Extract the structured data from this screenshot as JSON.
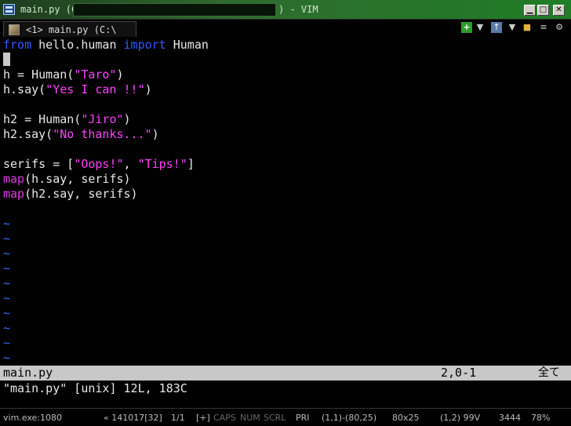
{
  "window": {
    "title_left": "main.py (C:",
    "title_right": ") - VIM"
  },
  "tab": {
    "label": "<1> main.py (C:\\"
  },
  "toolbar_icons": [
    "plus-icon",
    "dropdown-icon",
    "upload-icon",
    "dropdown-icon",
    "lock-icon",
    "gear-icon"
  ],
  "editor": {
    "lines": [
      {
        "parts": [
          {
            "t": "from",
            "c": "kw"
          },
          {
            "t": " hello.human "
          },
          {
            "t": "import",
            "c": "kw"
          },
          {
            "t": " Human"
          }
        ]
      },
      {
        "parts": [],
        "cursor": true
      },
      {
        "parts": [
          {
            "t": "h = Human("
          },
          {
            "t": "\"Taro\"",
            "c": "str"
          },
          {
            "t": ")"
          }
        ]
      },
      {
        "parts": [
          {
            "t": "h.say("
          },
          {
            "t": "\"Yes I can !!\"",
            "c": "str"
          },
          {
            "t": ")"
          }
        ]
      },
      {
        "parts": []
      },
      {
        "parts": [
          {
            "t": "h2 = Human("
          },
          {
            "t": "\"Jiro\"",
            "c": "str"
          },
          {
            "t": ")"
          }
        ]
      },
      {
        "parts": [
          {
            "t": "h2.say("
          },
          {
            "t": "\"No thanks...\"",
            "c": "str"
          },
          {
            "t": ")"
          }
        ]
      },
      {
        "parts": []
      },
      {
        "parts": [
          {
            "t": "serifs = ["
          },
          {
            "t": "\"Oops!\"",
            "c": "str"
          },
          {
            "t": ", "
          },
          {
            "t": "\"Tips!\"",
            "c": "str"
          },
          {
            "t": "]"
          }
        ]
      },
      {
        "parts": [
          {
            "t": "map",
            "c": "fn"
          },
          {
            "t": "(h.say, serifs)"
          }
        ]
      },
      {
        "parts": [
          {
            "t": "map",
            "c": "fn"
          },
          {
            "t": "(h2.say, serifs)"
          }
        ]
      }
    ],
    "tilde": "~",
    "tilde_count": 10
  },
  "statusline": {
    "filename": "main.py",
    "position": "2,0-1",
    "percent": "全て"
  },
  "cmdline": {
    "message": "\"main.py\" [unix] 12L, 183C"
  },
  "console": {
    "process": "vim.exe:1080",
    "build": "« 141017[32]",
    "tabs": "1/1",
    "flags": "[+]",
    "caps": "CAPS",
    "num": "NUM",
    "scrl": "SCRL",
    "pri": "PRI",
    "region": "(1,1)-(80,25)",
    "size": "80x25",
    "cursor": "(1,2) 99V",
    "pid": "3444",
    "percent": "78%"
  },
  "colors": {
    "keyword": "#2f5cff",
    "function": "#e038e0",
    "string": "#ff40ff",
    "tilde": "#2f6fff",
    "titlebar": "#2f6b2f"
  }
}
